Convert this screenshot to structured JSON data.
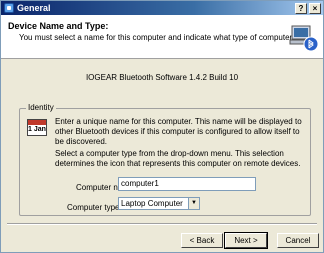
{
  "window": {
    "title": "General",
    "help_label": "?",
    "close_label": "×"
  },
  "header": {
    "title": "Device Name and Type:",
    "subtitle": "You must select a name for this computer and indicate what type of computer it is.",
    "icon": "computer-bluetooth-icon"
  },
  "version_text": "IOGEAR Bluetooth Software 1.4.2 Build 10",
  "identity": {
    "legend": "Identity",
    "icon": "calendar-icon",
    "icon_text": "1 Jan",
    "para1": "Enter a unique name for this computer.  This name will be displayed to other Bluetooth devices if this computer is configured to allow itself to be discovered.",
    "para2": "Select a computer type from the drop-down menu.  This selection determines the icon that represents this computer on remote devices.",
    "name_label": "Computer name:",
    "name_value": "computer1",
    "type_label": "Computer type:",
    "type_value": "Laptop Computer"
  },
  "buttons": {
    "back": "< Back",
    "next": "Next >",
    "cancel": "Cancel"
  },
  "colors": {
    "titlebar": "#0a246a",
    "face": "#ece9d8",
    "header_bg": "#ffffff"
  }
}
